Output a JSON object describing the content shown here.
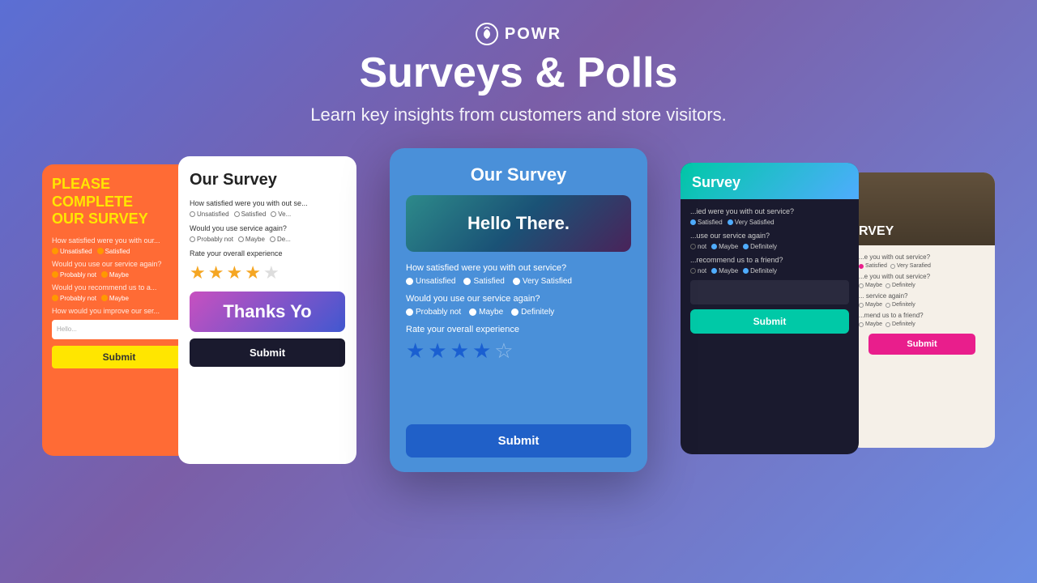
{
  "header": {
    "logo_text": "POWR",
    "title": "Surveys & Polls",
    "subtitle": "Learn key insights from customers and store visitors."
  },
  "card_far_left": {
    "title": "PLEASE COMPLETE OUR SURVEY",
    "q1": "How satisfied were you with our...",
    "q1_options": [
      "Unsatisfied",
      "Satisfied"
    ],
    "q2": "Would you use our service again?",
    "q2_options": [
      "Probably not",
      "Maybe"
    ],
    "q3": "Would you recommend us to a...",
    "q3_options": [
      "Probably not",
      "Maybe"
    ],
    "q4": "How would you improve our ser...",
    "input_placeholder": "Hello...",
    "submit_label": "Submit"
  },
  "card_left": {
    "title": "Our Survey",
    "q1": "How satisfied were you with out se...",
    "q1_options": [
      "Unsatisfied",
      "Satisfied",
      "Ve..."
    ],
    "q2": "Would you use service again?",
    "q2_options": [
      "Probably not",
      "Maybe",
      "De..."
    ],
    "rate_label": "Rate  your overall experience",
    "stars_filled": 4,
    "stars_total": 5,
    "thanks_text": "Thanks Yo",
    "submit_label": "Submit"
  },
  "card_center": {
    "title": "Our Survey",
    "hero_text": "Hello There.",
    "q1": "How satisfied were you with out service?",
    "q1_options": [
      "Unsatisfied",
      "Satisfied",
      "Very Satisfied"
    ],
    "q2": "Would you use our service again?",
    "q2_options": [
      "Probably not",
      "Maybe",
      "Definitely"
    ],
    "rate_label": "Rate  your overall experience",
    "stars_filled": 4,
    "stars_total": 5,
    "submit_label": "Submit"
  },
  "card_right": {
    "header_title": "Survey",
    "q1": "...ied were you with out service?",
    "q1_options": [
      "Satisfied",
      "Very Satisfied"
    ],
    "q2": "...use our service again?",
    "q2_options": [
      "not",
      "Maybe",
      "Definitely"
    ],
    "q3": "...recommend us to a friend?",
    "q3_options": [
      "not",
      "Maybe",
      "Definitely"
    ],
    "submit_label": "Submit"
  },
  "card_far_right": {
    "header_title": "RVEY",
    "q1": "...e you with out service?",
    "q1_options": [
      "Satisfied",
      "Very Satisfied"
    ],
    "q2": "...e you with out service?",
    "q2_options": [
      "Maybe",
      "Definitely"
    ],
    "q3": "... service again?",
    "q3_options": [
      "Maybe",
      "Definitely"
    ],
    "q4": "...mend us to a friend?",
    "q4_options": [
      "Maybe",
      "Definitely"
    ],
    "submit_label": "Submit"
  },
  "colors": {
    "bg_gradient_start": "#5b6fd4",
    "bg_gradient_end": "#6b8de3",
    "orange_card": "#ff6b35",
    "yellow_accent": "#ffe600",
    "blue_center": "#4a90d9",
    "dark_card": "#1a1a2e",
    "teal_accent": "#00c9a7",
    "pink_accent": "#e91e8c",
    "submit_blue": "#2060c8"
  }
}
